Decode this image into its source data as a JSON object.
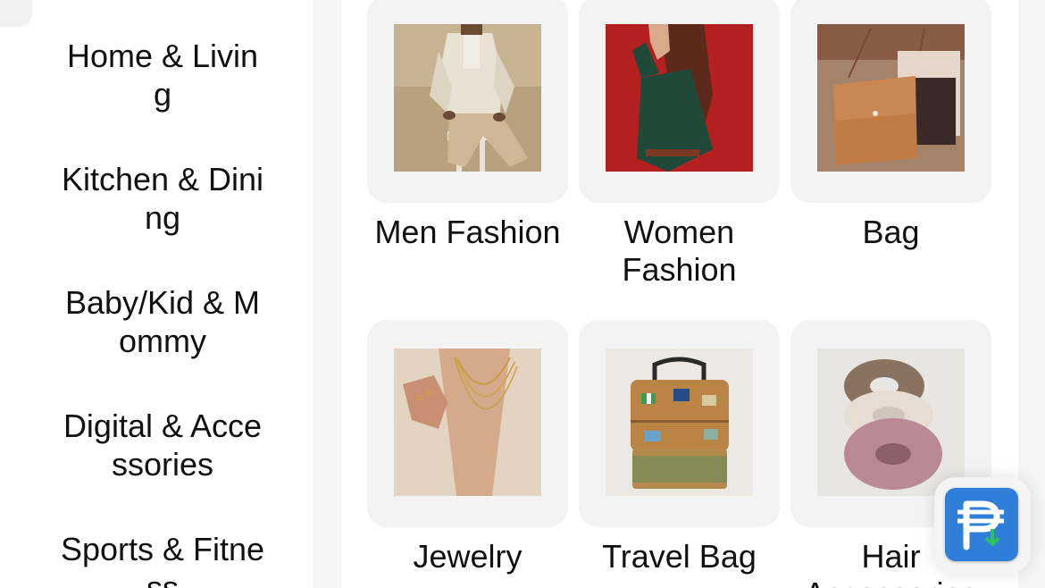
{
  "sidebar": {
    "items": [
      {
        "label": "Home & Living"
      },
      {
        "label": "Kitchen & Dining"
      },
      {
        "label": "Baby/Kid & Mommy"
      },
      {
        "label": "Digital & Accessories"
      },
      {
        "label": "Sports & Fitness"
      }
    ]
  },
  "categories": [
    {
      "label": "Men Fashion",
      "icon": "men-fashion-image"
    },
    {
      "label": "Women Fashion",
      "icon": "women-fashion-image"
    },
    {
      "label": "Bag",
      "icon": "bag-image"
    },
    {
      "label": "Jewelry",
      "icon": "jewelry-image"
    },
    {
      "label": "Travel Bag",
      "icon": "travel-bag-image"
    },
    {
      "label": "Hair Accessories",
      "icon": "hair-accessories-image"
    }
  ],
  "floating_badge": {
    "icon": "peso-download-icon",
    "color": "#2f7ed8"
  }
}
